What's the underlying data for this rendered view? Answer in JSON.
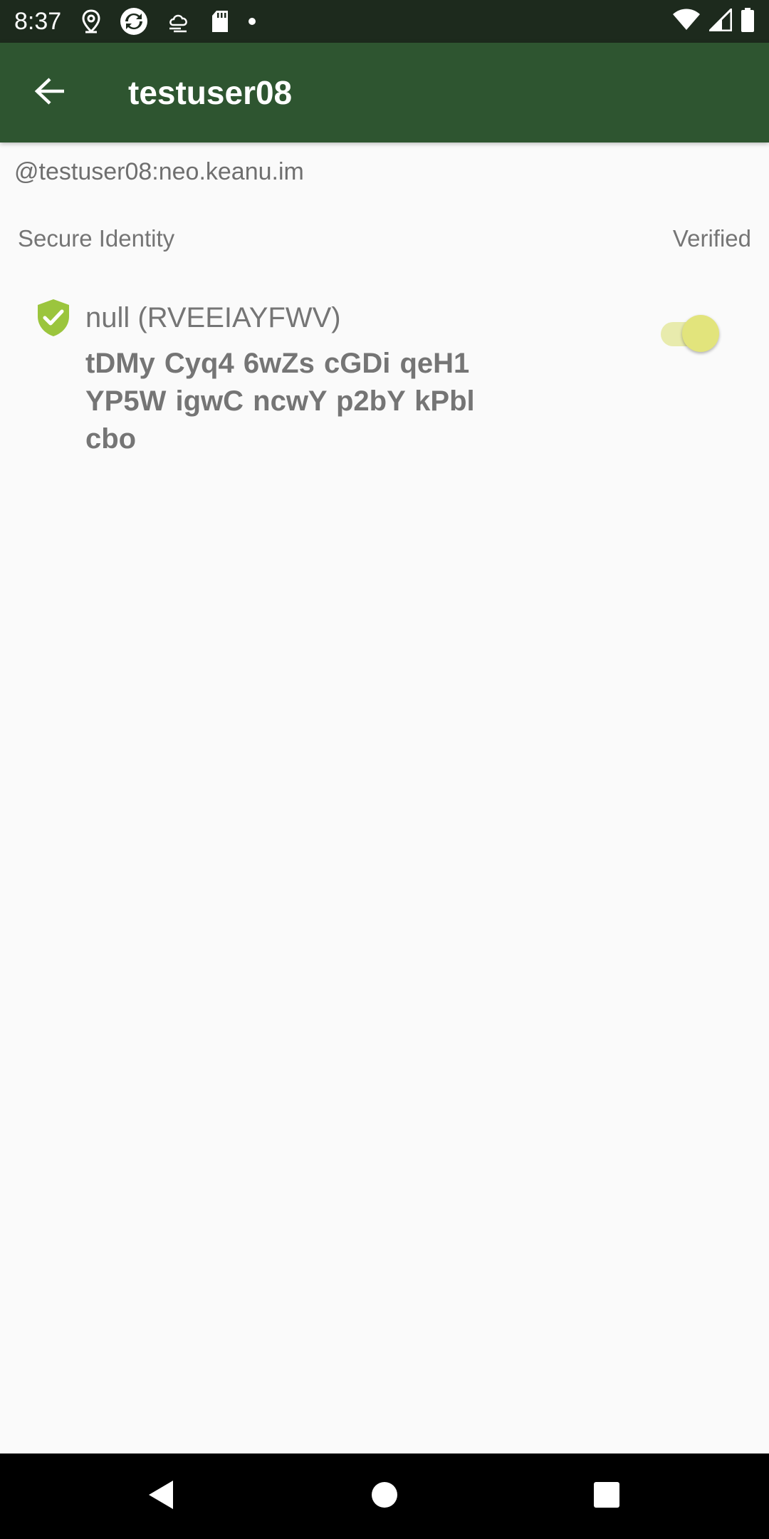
{
  "status_bar": {
    "time": "8:37",
    "left_icons": [
      "location-icon",
      "sync-icon",
      "weather-icon",
      "sd-card-icon",
      "notification-dot-icon"
    ],
    "right_icons": [
      "wifi-icon",
      "cellular-signal-icon",
      "battery-icon"
    ]
  },
  "app_bar": {
    "title": "testuser08",
    "back_icon": "arrow-back-icon"
  },
  "user": {
    "matrix_id": "@testuser08:neo.keanu.im"
  },
  "section": {
    "left_label": "Secure Identity",
    "right_label": "Verified"
  },
  "device": {
    "name": "null (RVEEIAYFWV)",
    "fingerprint": "tDMy Cyq4 6wZs cGDi qeH1 YP5W igwC ncwY p2bY kPbl cbo",
    "verified": true
  },
  "colors": {
    "status_bar": "#1d2a1d",
    "app_bar": "#2e5530",
    "background": "#fafafa",
    "shield": "#9bc53d",
    "switch_thumb": "#e2e47c",
    "switch_track": "#e8ebad"
  }
}
